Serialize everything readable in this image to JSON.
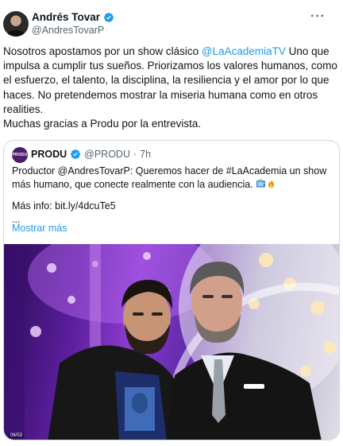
{
  "author": {
    "name": "Andrés Tovar",
    "handle": "@AndresTovarP",
    "verified_icon": "verified-badge",
    "more_icon": "more-dots"
  },
  "post": {
    "text_before_mention": "Nosotros apostamos por un show clásico ",
    "mention": "@LaAcademiaTV",
    "text_after_mention": " Uno que impulsa a cumplir tus sueños. Priorizamos los valores humanos, como el esfuerzo, el talento, la disciplina, la resiliencia y el amor por lo que haces. No pretendemos mostrar la miseria humana como en otros realities.",
    "line2": "Muchas gracias a Produ por la entrevista."
  },
  "quote": {
    "avatar_text": "PRODU",
    "name": "PRODU",
    "handle": "@PRODU",
    "separator": "·",
    "time": "7h",
    "line1": "Productor @AndresTovarP: Queremos hacer de #LaAcademia un show más humano, que conecte realmente con la audiencia.",
    "emojis": [
      "tv-icon",
      "fire-icon"
    ],
    "line2": "Más info: bit.ly/4dcuTe5",
    "line3": "...",
    "show_more": "Mostrar más",
    "watermark": "06/53"
  },
  "colors": {
    "link": "#1d9bf0",
    "text": "#0f1419",
    "secondary": "#536471",
    "border": "#cfd9de"
  }
}
